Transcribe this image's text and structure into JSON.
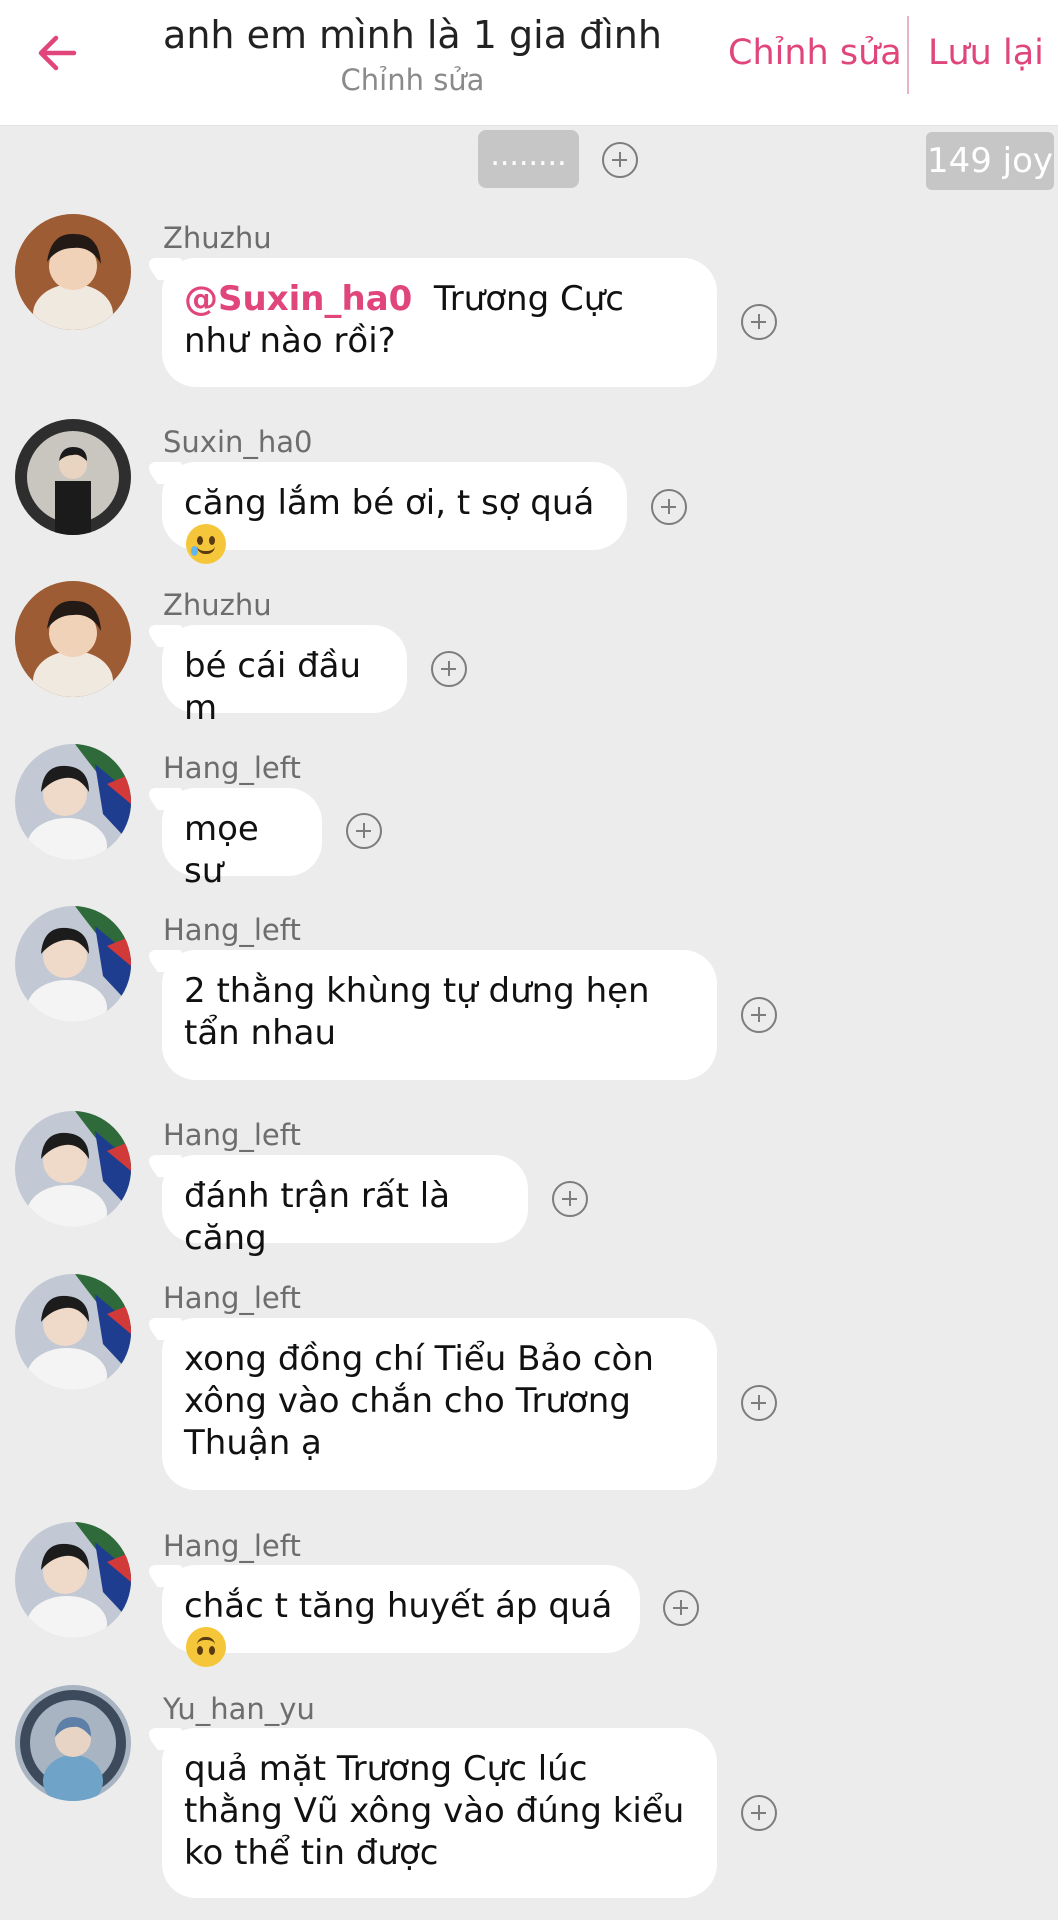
{
  "header": {
    "title": "anh em mình là 1 gia đình",
    "subtitle": "Chỉnh sửa",
    "edit_label": "Chỉnh sửa",
    "save_label": "Lưu lại",
    "accent_color": "#e0457c"
  },
  "top_strip": {
    "dots": "........",
    "joy_label": "149 joy"
  },
  "messages": [
    {
      "sender": "Zhuzhu",
      "mention": "@Suxin_ha0",
      "text": "Trương Cực như nào rồi?"
    },
    {
      "sender": "Suxin_ha0",
      "text": "căng lắm bé ơi, t sợ quá",
      "emoji": "smiling-face-with-tear"
    },
    {
      "sender": "Zhuzhu",
      "text": "bé cái đầu m"
    },
    {
      "sender": "Hang_left",
      "text": "mọe sư"
    },
    {
      "sender": "Hang_left",
      "text": "2 thằng khùng tự dưng hẹn tẩn nhau"
    },
    {
      "sender": "Hang_left",
      "text": "đánh trận rất là căng"
    },
    {
      "sender": "Hang_left",
      "text": "xong đồng chí Tiểu Bảo còn xông vào chắn cho Trương Thuận ạ"
    },
    {
      "sender": "Hang_left",
      "text": "chắc t tăng huyết áp quá",
      "emoji": "upside-down-face"
    },
    {
      "sender": "Yu_han_yu",
      "text": "quả mặt Trương Cực lúc thằng Vũ xông vào đúng kiểu ko thể tin được"
    }
  ]
}
